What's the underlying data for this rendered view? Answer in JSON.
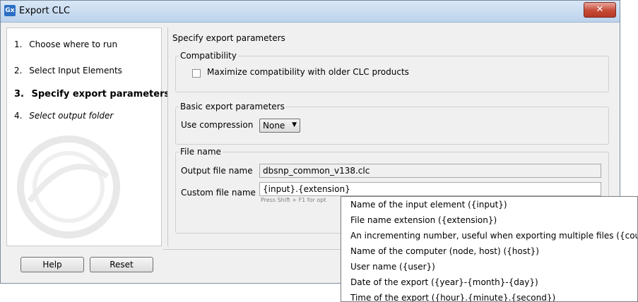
{
  "window": {
    "icon_text": "Gx",
    "title": "Export CLC",
    "close_glyph": "✕"
  },
  "wizard": {
    "steps": [
      {
        "number": "1.",
        "label": "Choose where to run",
        "state": "done"
      },
      {
        "number": "2.",
        "label": "Select Input Elements",
        "state": "done"
      },
      {
        "number": "3.",
        "label": "Specify export parameters",
        "state": "current"
      },
      {
        "number": "4.",
        "label": "Select output folder",
        "state": "future"
      }
    ]
  },
  "content": {
    "title": "Specify export parameters",
    "compatibility": {
      "legend": "Compatibility",
      "checkbox_label": "Maximize compatibility with older CLC products",
      "checked": false
    },
    "basic": {
      "legend": "Basic export parameters",
      "compression_label": "Use compression",
      "compression_value": "None"
    },
    "file_name": {
      "legend": "File name",
      "output_label": "Output file name",
      "output_value": "dbsnp_common_v138.clc",
      "custom_label": "Custom file name",
      "custom_value": "{input}.{extension}",
      "hint": "Press Shift + F1 for opt"
    }
  },
  "buttons": {
    "help": "Help",
    "reset": "Reset"
  },
  "popup": {
    "items": [
      "Name of the input element ({input})",
      "File name extension ({extension})",
      "An incrementing number, useful when exporting multiple files ({counter})",
      "Name of the computer (node, host) ({host})",
      "User name ({user})",
      "Date of the export ({year}-{month}-{day})",
      "Time of the export ({hour}.{minute}.{second})"
    ]
  },
  "colors": {
    "titlebar": "#bcd3ec",
    "close_button": "#c64a36",
    "dialog_bg": "#f0f0f0"
  }
}
